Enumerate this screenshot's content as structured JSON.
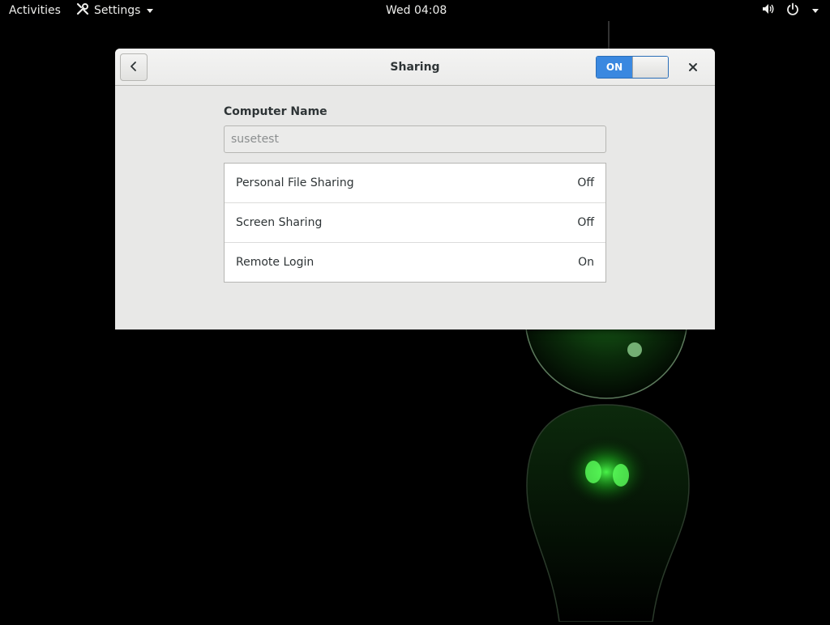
{
  "topbar": {
    "activities_label": "Activities",
    "app_menu_label": "Settings",
    "clock": "Wed 04:08"
  },
  "window": {
    "title": "Sharing",
    "main_switch_label": "ON",
    "main_switch_state": "on",
    "computer_name_label": "Computer Name",
    "computer_name_value": "susetest",
    "services": [
      {
        "name": "Personal File Sharing",
        "status": "Off"
      },
      {
        "name": "Screen Sharing",
        "status": "Off"
      },
      {
        "name": "Remote Login",
        "status": "On"
      }
    ]
  },
  "colors": {
    "switch_on": "#3a88e0",
    "wallpaper_glow": "#2fd52f"
  },
  "icons": [
    "settings-tools-icon",
    "volume-icon",
    "power-icon",
    "back-arrow-icon",
    "close-icon"
  ]
}
